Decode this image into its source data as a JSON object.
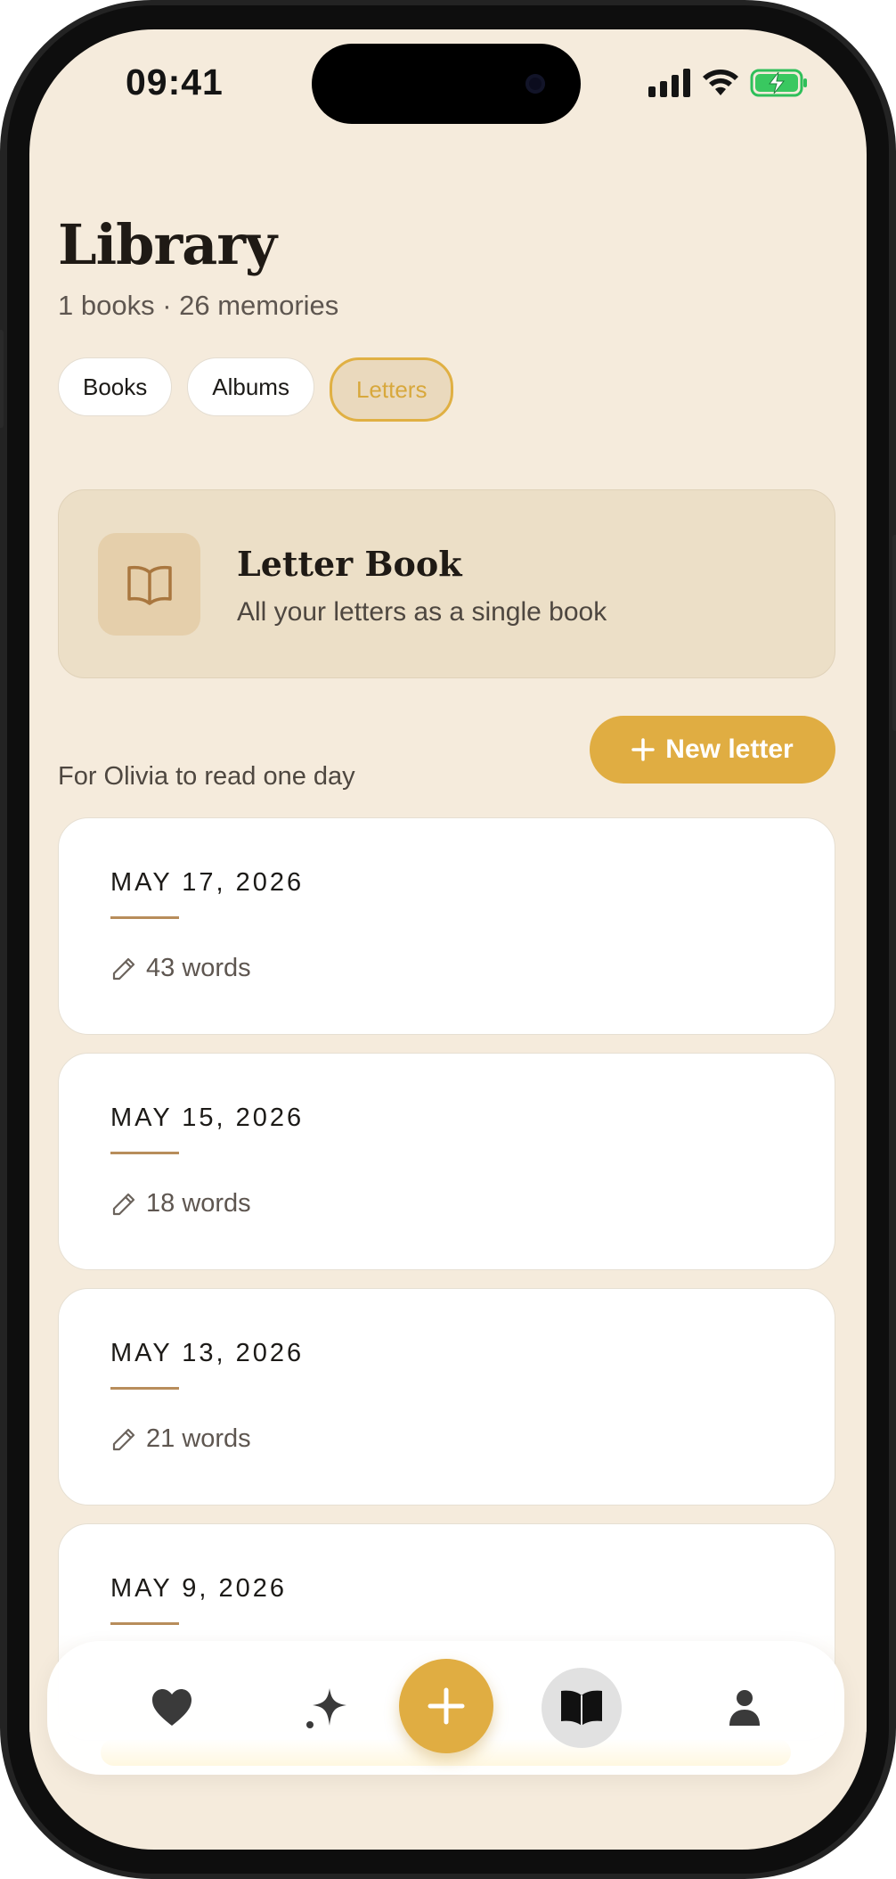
{
  "status_bar": {
    "time": "09:41"
  },
  "header": {
    "title": "Library",
    "subtitle": "1 books · 26 memories"
  },
  "tabs": [
    {
      "label": "Books",
      "active": false
    },
    {
      "label": "Albums",
      "active": false
    },
    {
      "label": "Letters",
      "active": true
    }
  ],
  "letter_book": {
    "title": "Letter Book",
    "subtitle": "All your letters as a single book",
    "icon": "open-book-icon"
  },
  "section": {
    "label": "For Olivia to read one day",
    "new_letter_label": "New letter"
  },
  "letters": [
    {
      "date": "MAY 17, 2026",
      "words": "43 words"
    },
    {
      "date": "MAY 15, 2026",
      "words": "18 words"
    },
    {
      "date": "MAY 13, 2026",
      "words": "21 words"
    },
    {
      "date": "MAY 9, 2026",
      "words": ""
    }
  ],
  "bottom_nav": {
    "items": [
      "heart-icon",
      "sparkle-icon",
      "plus-icon",
      "book-icon",
      "person-icon"
    ],
    "active": "book-icon"
  },
  "colors": {
    "accent": "#e0ad42",
    "background": "#f5ebdc",
    "card": "#ffffff",
    "book_card": "#ecdfc7",
    "rule": "#b88d5b"
  }
}
